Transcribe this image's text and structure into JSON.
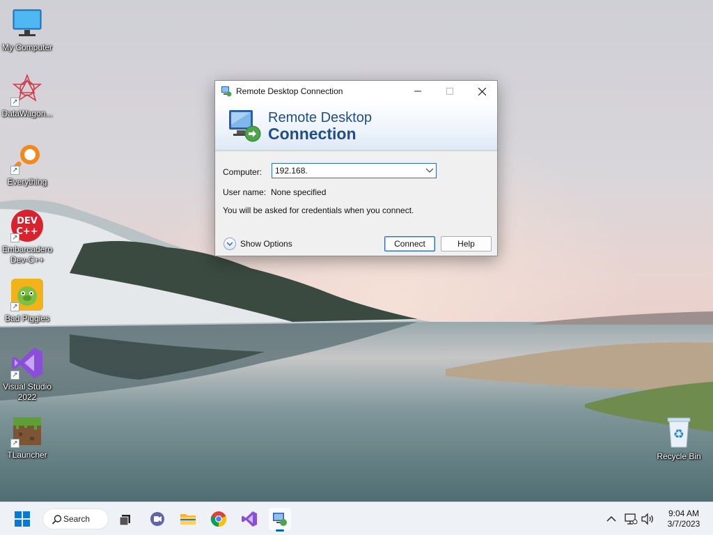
{
  "desktop": {
    "icons": [
      {
        "label": "My Computer"
      },
      {
        "label": "DataWagon..."
      },
      {
        "label": "Everything"
      },
      {
        "label": "Embarcadero\nDev-C++"
      },
      {
        "label": "Bad Piggies"
      },
      {
        "label": "Visual Studio\n2022"
      },
      {
        "label": "TLauncher"
      },
      {
        "label": "Recycle Bin"
      }
    ]
  },
  "window": {
    "title": "Remote Desktop Connection",
    "banner_line1": "Remote Desktop",
    "banner_line2": "Connection",
    "computer_label": "Computer:",
    "computer_value": "192.168.",
    "user_label": "User name:",
    "user_value": "None specified",
    "note": "You will be asked for credentials when you connect.",
    "show_options": "Show Options",
    "connect_button": "Connect",
    "help_button": "Help"
  },
  "taskbar": {
    "search_label": "Search",
    "time": "9:04 AM",
    "date": "3/7/2023"
  },
  "colors": {
    "accent": "#0067c0",
    "banner_text": "#1f4e8a",
    "taskbar_bg": "#eef1f6"
  }
}
